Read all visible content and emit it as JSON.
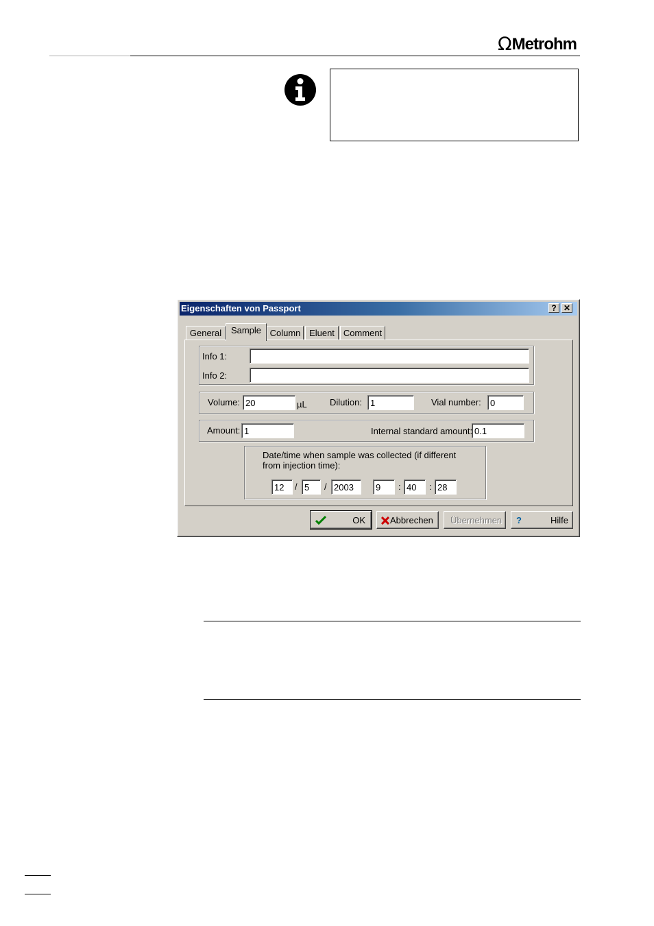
{
  "header": {
    "logo_symbol": "Ω",
    "logo_text": "Metrohm"
  },
  "dialog": {
    "title": "Eigenschaften von Passport",
    "help_button": "?",
    "close_button": "✕",
    "tabs": [
      "General",
      "Sample",
      "Column",
      "Eluent",
      "Comment"
    ],
    "active_tab": "Sample",
    "info1_label": "Info 1:",
    "info1_value": "",
    "info2_label": "Info 2:",
    "info2_value": "",
    "volume_label": "Volume:",
    "volume_value": "20",
    "volume_unit": "µL",
    "dilution_label": "Dilution:",
    "dilution_value": "1",
    "vial_label": "Vial number:",
    "vial_value": "0",
    "amount_label": "Amount:",
    "amount_value": "1",
    "istd_label": "Internal standard amount:",
    "istd_value": "0.1",
    "datetime_caption_1": "Date/time when sample was collected (if different",
    "datetime_caption_2": "from injection time):",
    "date_day": "12",
    "date_month": "5",
    "date_year": "2003",
    "time_h": "9",
    "time_m": "40",
    "time_s": "28",
    "sep_slash": "/",
    "sep_colon": ":",
    "ok_label": "OK",
    "cancel_label": "Abbrechen",
    "apply_label": "Übernehmen",
    "help_label": "Hilfe",
    "check_icon": "check-icon",
    "cross_icon": "cross-icon",
    "help_icon": "question-icon"
  }
}
